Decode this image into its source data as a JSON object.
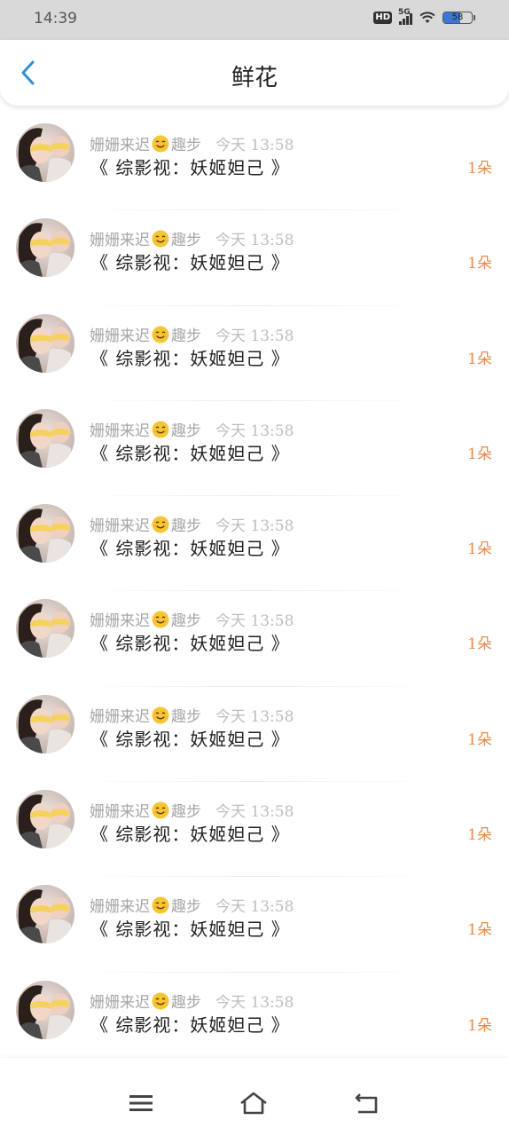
{
  "status_bar": {
    "time": "14:39",
    "hd_label": "HD",
    "network_label": "5G",
    "battery_level": "58",
    "battery_fraction": 0.58,
    "icons": [
      "hd-icon",
      "signal-icon",
      "wifi-icon",
      "battery-icon"
    ]
  },
  "header": {
    "title": "鲜花",
    "back_icon": "chevron-left-icon",
    "accent_color": "#2f8fd6"
  },
  "items": [
    {
      "user": "姗姗来迟",
      "gift_type": "趣步",
      "time": "今天 13:58",
      "title": "《 综影视：妖姬妲己 》",
      "count": "1朵"
    },
    {
      "user": "姗姗来迟",
      "gift_type": "趣步",
      "time": "今天 13:58",
      "title": "《 综影视：妖姬妲己 》",
      "count": "1朵"
    },
    {
      "user": "姗姗来迟",
      "gift_type": "趣步",
      "time": "今天 13:58",
      "title": "《 综影视：妖姬妲己 》",
      "count": "1朵"
    },
    {
      "user": "姗姗来迟",
      "gift_type": "趣步",
      "time": "今天 13:58",
      "title": "《 综影视：妖姬妲己 》",
      "count": "1朵"
    },
    {
      "user": "姗姗来迟",
      "gift_type": "趣步",
      "time": "今天 13:58",
      "title": "《 综影视：妖姬妲己 》",
      "count": "1朵"
    },
    {
      "user": "姗姗来迟",
      "gift_type": "趣步",
      "time": "今天 13:58",
      "title": "《 综影视：妖姬妲己 》",
      "count": "1朵"
    },
    {
      "user": "姗姗来迟",
      "gift_type": "趣步",
      "time": "今天 13:58",
      "title": "《 综影视：妖姬妲己 》",
      "count": "1朵"
    },
    {
      "user": "姗姗来迟",
      "gift_type": "趣步",
      "time": "今天 13:58",
      "title": "《 综影视：妖姬妲己 》",
      "count": "1朵"
    },
    {
      "user": "姗姗来迟",
      "gift_type": "趣步",
      "time": "今天 13:58",
      "title": "《 综影视：妖姬妲己 》",
      "count": "1朵"
    },
    {
      "user": "姗姗来迟",
      "gift_type": "趣步",
      "time": "今天 13:58",
      "title": "《 综影视：妖姬妲己 》",
      "count": "1朵"
    }
  ],
  "item_icons": {
    "emoji": "smiling-face-icon",
    "avatar": "user-avatar"
  },
  "colors": {
    "count": "#e88a48",
    "meta": "#a6a6a6",
    "status_bar_bg": "#d9d9d9",
    "battery_fill": "#3a78d4"
  },
  "nav_buttons": [
    "menu-icon",
    "home-icon",
    "back-icon"
  ]
}
